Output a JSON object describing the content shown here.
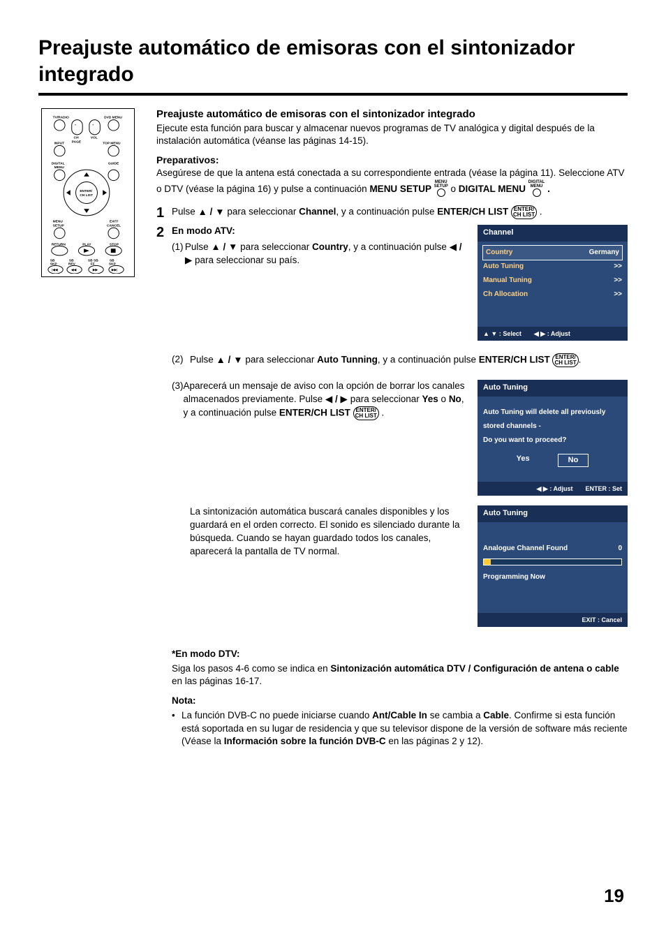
{
  "title": "Preajuste automático de emisoras con el sintonizador integrado",
  "section_heading": "Preajuste automático de emisoras con el sintonizador integrado",
  "intro": "Ejecute esta función para buscar y almacenar nuevos programas de TV analógica y digital después de la instalación automática (véanse las páginas 14-15).",
  "preparativos_head": "Preparativos:",
  "prep_text_a": "Asegúrese de que la antena está conectada a su correspondiente entrada (véase la página 11). Seleccione ATV o DTV (véase la página 16) y pulse a continuación ",
  "menu_setup": "MENU SETUP",
  "prep_text_b": " o ",
  "digital_menu": "DIGITAL MENU",
  "prep_text_c": " .",
  "step1_a": "Pulse ",
  "step1_b": " para seleccionar ",
  "channel_word": "Channel",
  "step1_c": ", y a continuación pulse ",
  "enter_chlist": "ENTER/CH LIST",
  "step1_d": " .",
  "step2_head": "En modo ATV:",
  "sub1_a": "Pulse ",
  "sub1_b": " para seleccionar ",
  "country_word": "Country",
  "sub1_c": ", y a continuación pulse ",
  "sub1_d": " para seleccionar su país.",
  "screen_channel": {
    "title": "Channel",
    "rows": [
      {
        "label": "Country",
        "val": "Germany"
      },
      {
        "label": "Auto Tuning",
        "val": ">>"
      },
      {
        "label": "Manual Tuning",
        "val": ">>"
      },
      {
        "label": "Ch Allocation",
        "val": ">>"
      }
    ],
    "footer_select": "▲ ▼ : Select",
    "footer_adjust": "◀ ▶ : Adjust"
  },
  "sub2_a": "Pulse ",
  "sub2_b": " para seleccionar ",
  "auto_tunning": "Auto Tunning",
  "sub2_c": ", y a continuación pulse ",
  "sub2_d": ".",
  "sub3_a": "Aparecerá un mensaje de aviso con la opción de borrar los canales almacenados previamente. Pulse ",
  "sub3_b": " para seleccionar ",
  "yes_word": "Yes",
  "or_word": " o ",
  "no_word": "No",
  "sub3_c": ", y a continuación pulse ",
  "sub3_d": " .",
  "screen_confirm": {
    "title": "Auto Tuning",
    "line1": "Auto Tuning will delete all previously",
    "line2": "stored channels -",
    "line3": "Do you want to proceed?",
    "yes": "Yes",
    "no": "No",
    "footer_adjust": "◀ ▶  : Adjust",
    "footer_set": "ENTER : Set"
  },
  "auto_search_text": "La sintonización automática buscará canales disponibles y los guardará en el orden correcto. El sonido es silenciado durante la búsqueda. Cuando se hayan guardado todos los canales, aparecerá la pantalla de TV normal.",
  "screen_progress": {
    "title": "Auto Tuning",
    "found_label": "Analogue Channel Found",
    "found_val": "0",
    "programming": "Programming Now",
    "footer": "EXIT : Cancel"
  },
  "dtv_head": "*En modo DTV:",
  "dtv_text_a": "Siga los pasos 4-6 como se indica en ",
  "dtv_bold": "Sintonización automática DTV / Configuración de antena o cable",
  "dtv_text_b": " en las páginas 16-17.",
  "nota_head": "Nota:",
  "nota_a": "La función DVB-C no puede iniciarse cuando ",
  "nota_b": "Ant/Cable In",
  "nota_c": " se cambia a ",
  "nota_d": "Cable",
  "nota_e": ". Confirme si esta función está soportada en su lugar de residencia y que su televisor dispone de la versión de software más reciente (Véase la ",
  "nota_f": "Información sobre la función DVB-C",
  "nota_g": " en las páginas 2 y 12).",
  "page_number": "19",
  "enter_icon_top": "ENTER/",
  "enter_icon_bot": "CH LIST",
  "menu_setup_tiny": "MENU",
  "menu_setup_tiny2": "SETUP",
  "digital_menu_tiny": "DIGITAL",
  "digital_menu_tiny2": "MENU",
  "remote_labels": {
    "tvradio": "TV/RADIO",
    "dvdmenu": "DVD MENU",
    "input": "INPUT",
    "topmenu": "TOP MENU",
    "chpage": "CH\nPAGE",
    "vol": "VOL",
    "digitalmenu": "DIGITAL\nMENU",
    "guide": "GUIDE",
    "enter": "ENTER/\nCH LIST",
    "menusetup": "MENU\nSETUP",
    "exitcancel": "EXIT/\nCANCEL",
    "return": "RETURN",
    "play": "PLAY",
    "stop": "STOP",
    "sbrev": "SB\nREV",
    "sbrev2": "SB REV",
    "sbskp": "SB\nSKP",
    "sbff": "SB SB\nFF",
    "sbskp2": "SB\nSKP"
  }
}
